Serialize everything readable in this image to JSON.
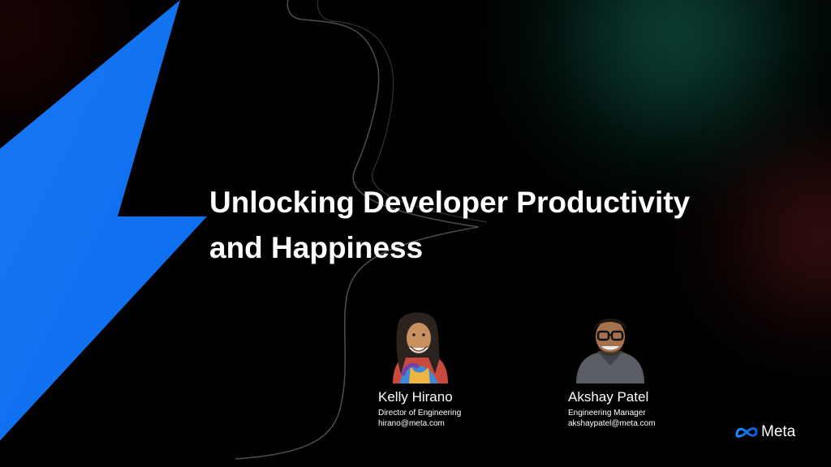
{
  "slide": {
    "title_line1": "Unlocking Developer Productivity",
    "title_line2": "and Happiness"
  },
  "speakers": [
    {
      "name": "Kelly Hirano",
      "role": "Director of Engineering",
      "email": "hirano@meta.com"
    },
    {
      "name": "Akshay Patel",
      "role": "Engineering Manager",
      "email": "akshaypatel@meta.com"
    }
  ],
  "brand": {
    "logo_text": "Meta",
    "logo_icon": "meta-infinity-icon"
  },
  "colors": {
    "background": "#000000",
    "bolt": "#1877F2",
    "text": "#FFFFFF"
  },
  "icons": [
    "lightning-bolt-icon",
    "curly-brace-icon",
    "meta-infinity-icon"
  ]
}
